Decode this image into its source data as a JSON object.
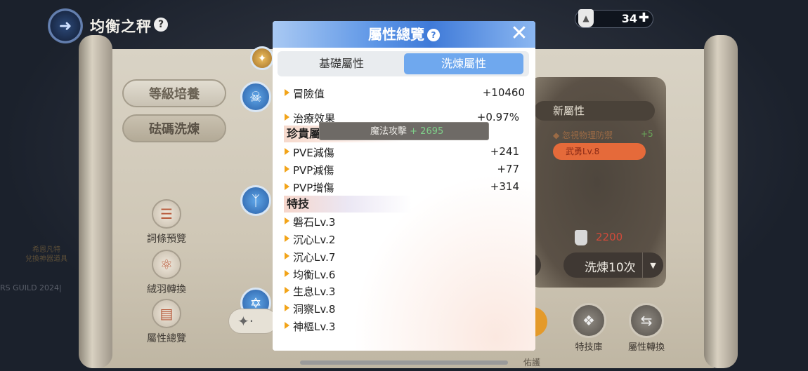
{
  "header": {
    "title": "均衡之秤",
    "help_icon": "question-mark-icon"
  },
  "currency": {
    "amount": "34",
    "icon": "weight-icon",
    "add_icon": "plus-icon"
  },
  "left_menu": {
    "level_train": "等級培養",
    "weight_refine": "砝碼洗煉"
  },
  "left_tools": [
    {
      "label": "詞條預覽",
      "icon": "list-icon"
    },
    {
      "label": "絨羽轉換",
      "icon": "swap-icon"
    },
    {
      "label": "屬性總覽",
      "icon": "book-icon"
    }
  ],
  "left_faint_text": {
    "line1": "希恩凡特",
    "line2": "兌換神器道具",
    "guild": "RS GUILD 2024|"
  },
  "right_panel": {
    "new_attr_title": "新屬性",
    "new_attr_item": "忽視物理防禦",
    "new_attr_plus": "+5",
    "new_attr_skill": "武勇Lv.8",
    "cost": "2200",
    "refine10_label": "洗煉10次",
    "protect_label": "佑護"
  },
  "bottom_tools": [
    {
      "label": "特技庫",
      "icon": "skill-scroll-icon"
    },
    {
      "label": "屬性轉換",
      "icon": "convert-icon"
    }
  ],
  "modal": {
    "title": "屬性總覽",
    "tabs": [
      "基礎屬性",
      "洗煉屬性"
    ],
    "active_tab": 1,
    "rows_top": [
      {
        "label": "冒險值",
        "value": "+10460"
      },
      {
        "label": "治療效果",
        "value": "+0.97%"
      }
    ],
    "section_rare": "珍貴屬性",
    "rows_rare": [
      {
        "label": "PVE減傷",
        "value": "+241"
      },
      {
        "label": "PVP減傷",
        "value": "+77"
      },
      {
        "label": "PVP增傷",
        "value": "+314"
      }
    ],
    "section_skills": "特技",
    "skills": [
      "磐石Lv.3",
      "沉心Lv.2",
      "沉心Lv.7",
      "均衡Lv.6",
      "生息Lv.3",
      "洞察Lv.8",
      "神樞Lv.3"
    ]
  },
  "tooltip": {
    "label": "魔法攻擊",
    "plus": "+ 2695"
  },
  "colors": {
    "accent_blue": "#6fa8ee",
    "arrow_orange": "#f2a419",
    "cost_red": "#d04a3a",
    "skill_orange": "#e56a3a"
  }
}
